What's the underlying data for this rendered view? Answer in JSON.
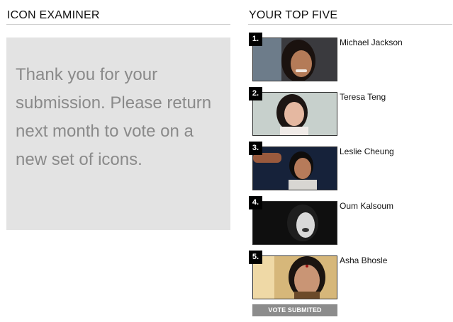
{
  "left_panel": {
    "title": "ICON EXAMINER",
    "message": "Thank you for your submission.  Please return next month to vote on a new set of icons."
  },
  "right_panel": {
    "title": "YOUR TOP FIVE",
    "items": [
      {
        "rank": "1.",
        "name": "Michael Jackson"
      },
      {
        "rank": "2.",
        "name": "Teresa Teng"
      },
      {
        "rank": "3.",
        "name": "Leslie Cheung"
      },
      {
        "rank": "4.",
        "name": "Oum Kalsoum"
      },
      {
        "rank": "5.",
        "name": "Asha Bhosle"
      }
    ],
    "vote_button_label": "VOTE SUBMITED"
  }
}
